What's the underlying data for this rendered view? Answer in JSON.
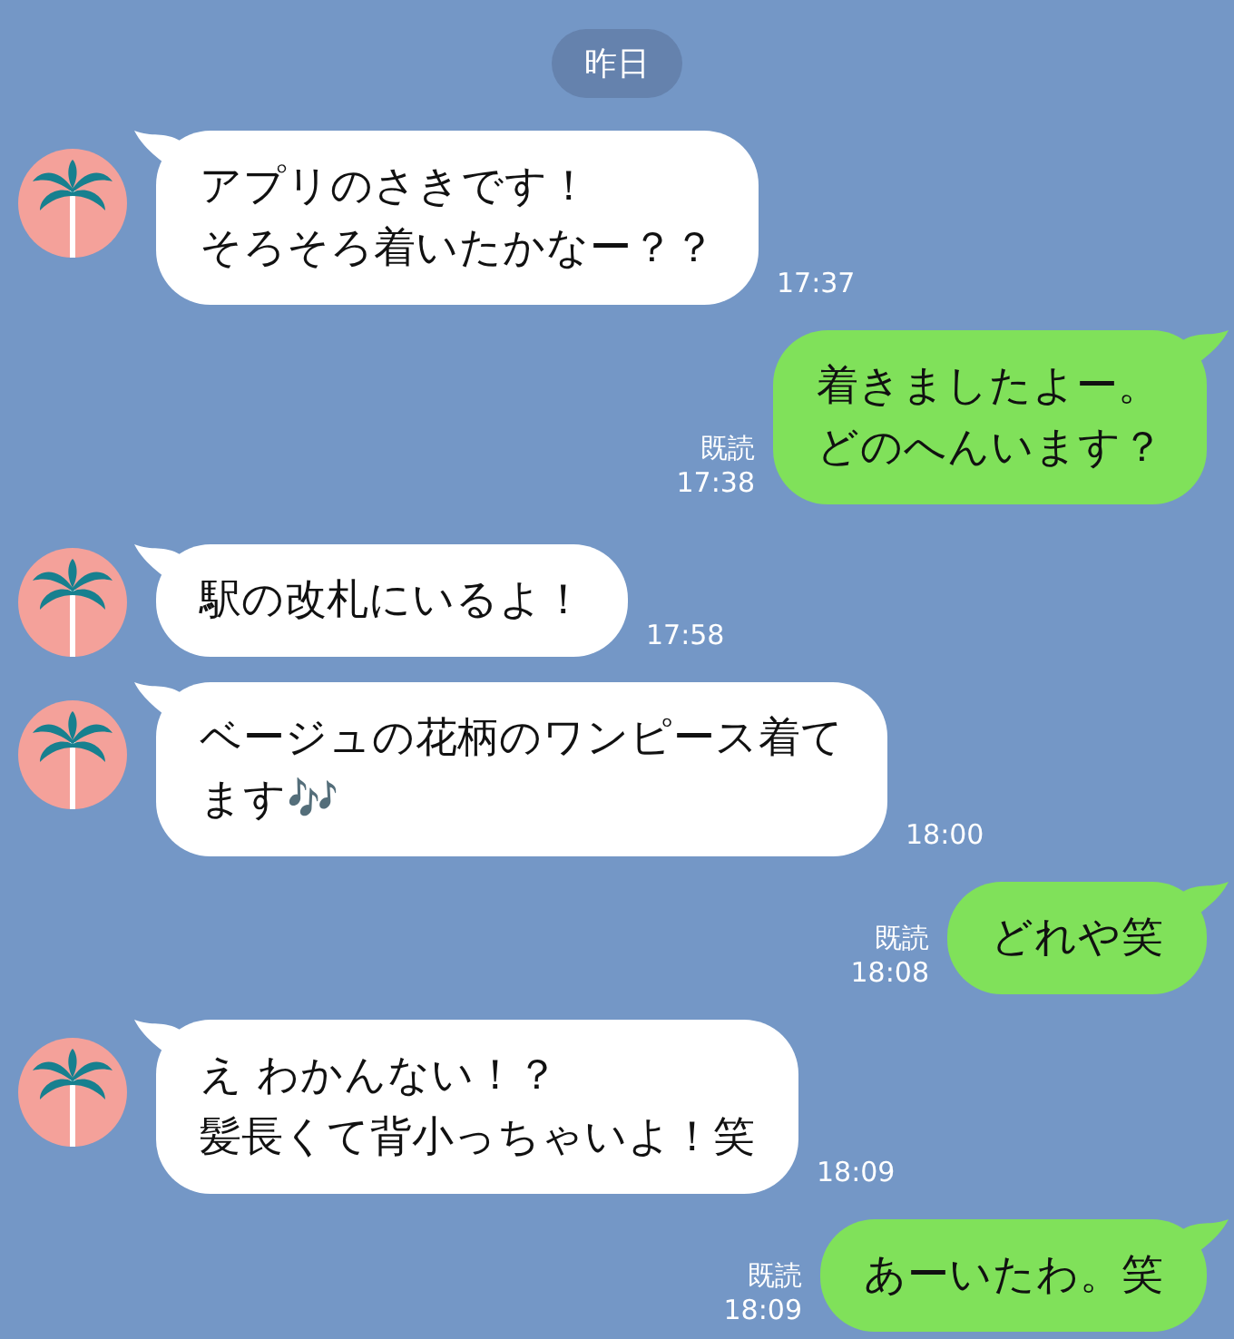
{
  "date_label": "昨日",
  "messages": [
    {
      "kind": "incoming",
      "lines": [
        "アプリのさきです！",
        "そろそろ着いたかなー？？"
      ],
      "time": "17:37"
    },
    {
      "kind": "outgoing",
      "lines": [
        "着きましたよー。",
        "どのへんいます？"
      ],
      "time": "17:38",
      "read_label": "既読"
    },
    {
      "kind": "incoming",
      "lines": [
        "駅の改札にいるよ！"
      ],
      "time": "17:58"
    },
    {
      "kind": "incoming",
      "lines": [
        "ベージュの花柄のワンピース着て",
        "ます🎶"
      ],
      "time": "18:00"
    },
    {
      "kind": "outgoing",
      "lines": [
        "どれや笑"
      ],
      "time": "18:08",
      "read_label": "既読"
    },
    {
      "kind": "incoming",
      "lines": [
        "え わかんない！？",
        "髪長くて背小っちゃいよ！笑"
      ],
      "time": "18:09"
    },
    {
      "kind": "outgoing",
      "lines": [
        "あーいたわ。笑"
      ],
      "time": "18:09",
      "read_label": "既読"
    }
  ]
}
